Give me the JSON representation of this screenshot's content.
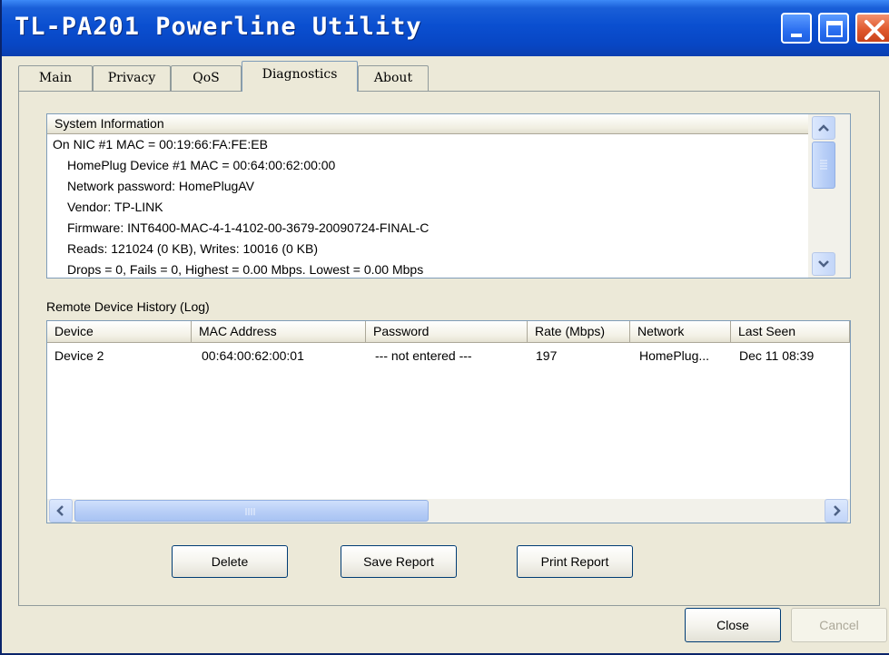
{
  "window": {
    "title": "TL-PA201 Powerline Utility"
  },
  "tabs": [
    {
      "label": "Main"
    },
    {
      "label": "Privacy"
    },
    {
      "label": "QoS"
    },
    {
      "label": "Diagnostics"
    },
    {
      "label": "About"
    }
  ],
  "system_info": {
    "header": "System Information",
    "lines": [
      "On NIC #1 MAC = 00:19:66:FA:FE:EB",
      "HomePlug Device #1 MAC = 00:64:00:62:00:00",
      "Network password: HomePlugAV",
      "Vendor: TP-LINK",
      "Firmware: INT6400-MAC-4-1-4102-00-3679-20090724-FINAL-C",
      "Reads: 121024 (0 KB), Writes: 10016 (0 KB)",
      "Drops = 0, Fails = 0, Highest = 0.00 Mbps. Lowest = 0.00 Mbps"
    ]
  },
  "history": {
    "label": "Remote Device History (Log)",
    "columns": [
      "Device",
      "MAC Address",
      "Password",
      "Rate (Mbps)",
      "Network",
      "Last Seen"
    ],
    "rows": [
      [
        "Device 2",
        "00:64:00:62:00:01",
        "--- not entered ---",
        "197",
        "HomePlug...",
        "Dec 11 08:39"
      ]
    ]
  },
  "buttons": {
    "delete": "Delete",
    "save_report": "Save Report",
    "print_report": "Print Report",
    "close": "Close",
    "cancel": "Cancel"
  },
  "colors": {
    "title_bar": "#0a4fd0",
    "window_bg": "#ece9d8",
    "close_button": "#e05a2e"
  }
}
